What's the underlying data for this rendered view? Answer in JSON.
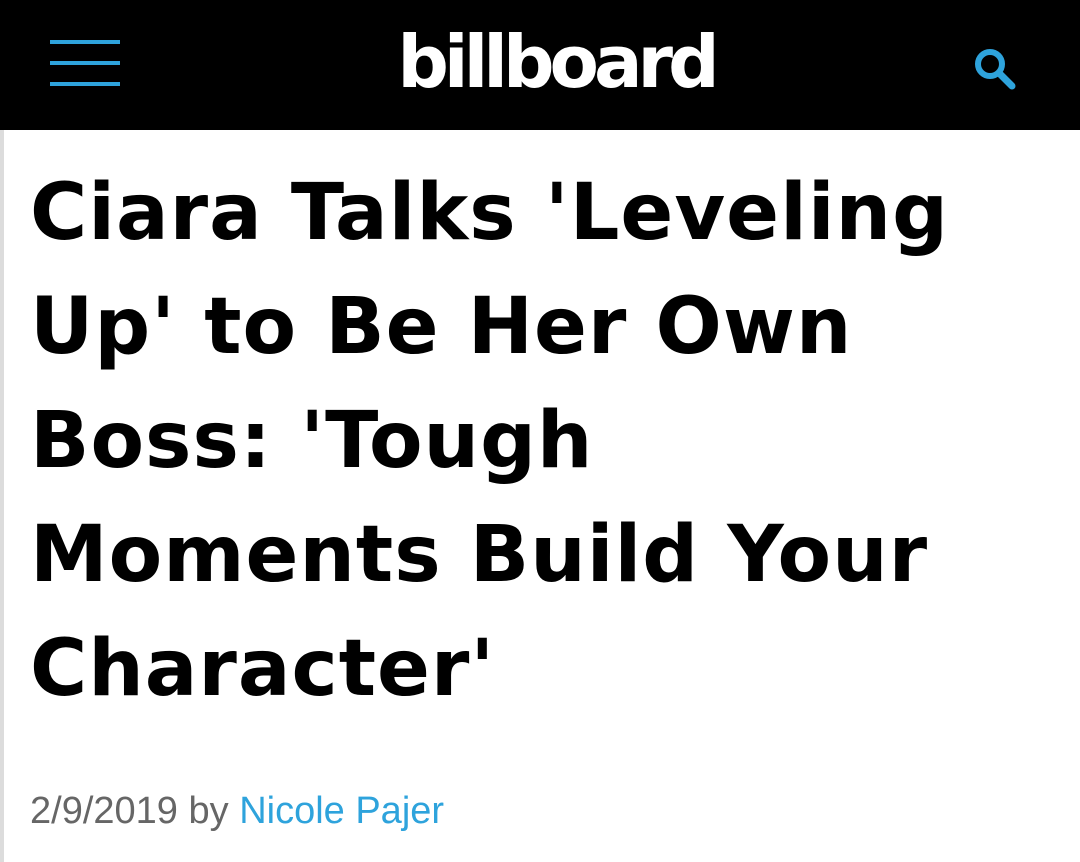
{
  "header": {
    "logo_text": "billboard",
    "menu_icon": "hamburger-menu-icon",
    "search_icon": "magnifier-search-icon",
    "background_color": "#000000",
    "accent_color": "#2ea3dc"
  },
  "article": {
    "headline_lines": [
      "Ciara Talks 'Leveling",
      "Up' to Be Her Own",
      "Boss: 'Tough",
      "Moments Build Your",
      "Character'"
    ],
    "date": "2/9/2019",
    "by_label": "by",
    "author": "Nicole Pajer"
  }
}
